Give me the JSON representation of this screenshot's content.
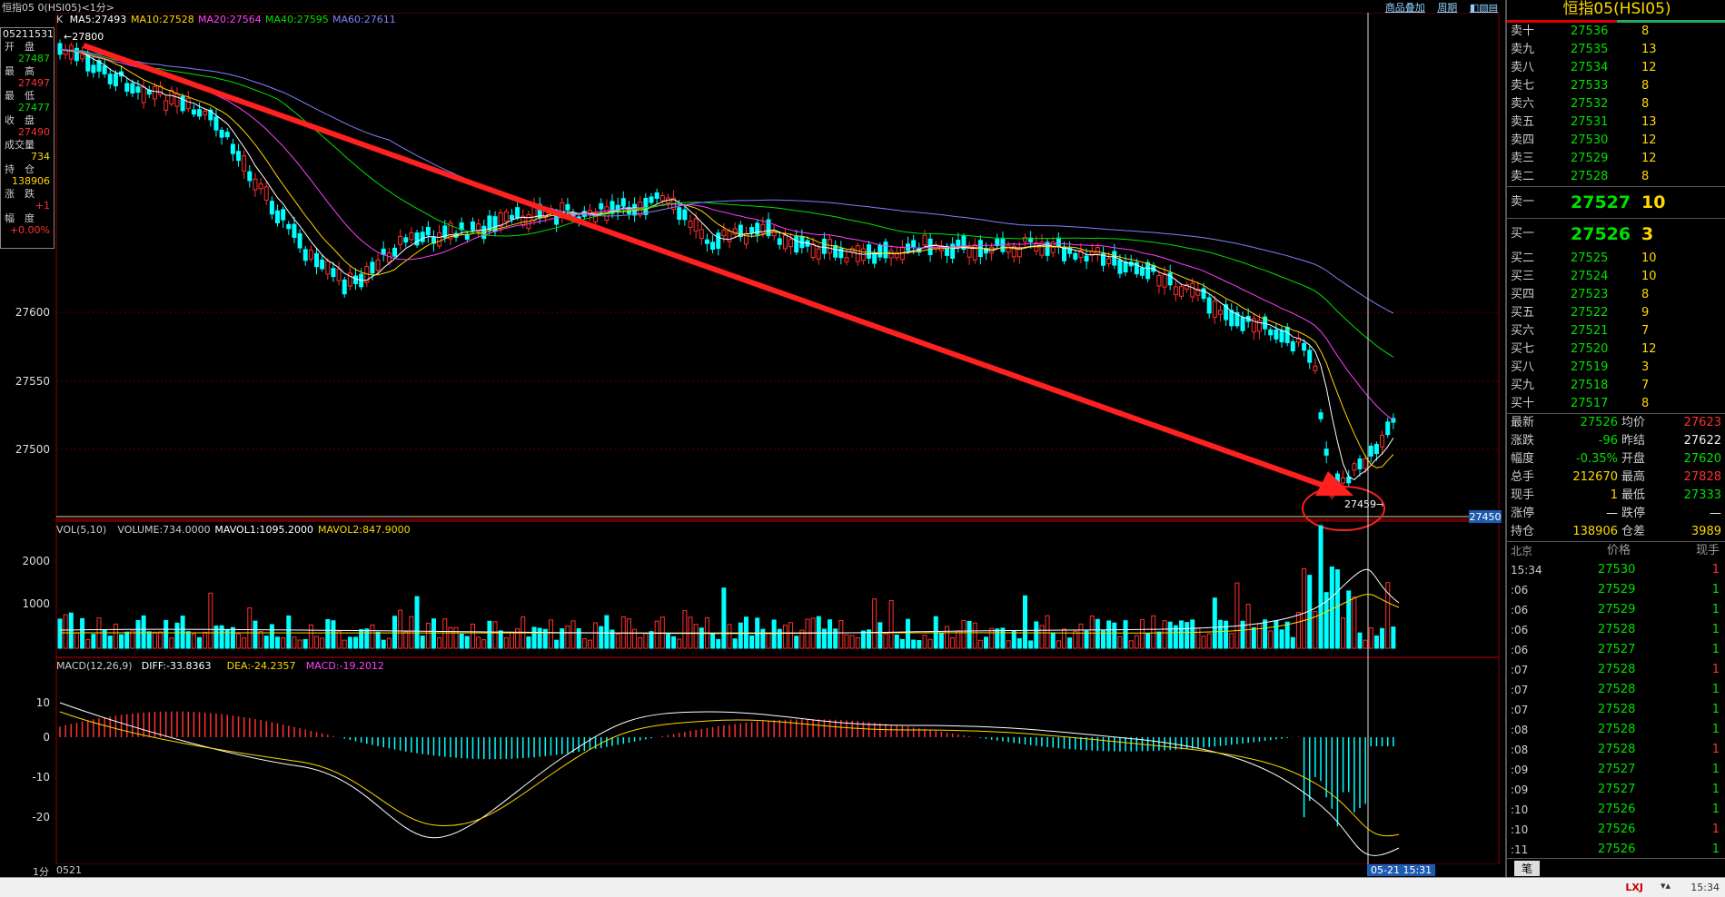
{
  "window": {
    "title": "恒指05 0(HSI05)<1分>",
    "buttons": [
      "商品叠加",
      "周期",
      "◧▧▤"
    ]
  },
  "ohlc_box": {
    "time": "05211531",
    "rows": [
      {
        "label": "开　盘",
        "value": "27487",
        "color": "#00e000"
      },
      {
        "label": "最　高",
        "value": "27497",
        "color": "#ff3030"
      },
      {
        "label": "最　低",
        "value": "27477",
        "color": "#00e000"
      },
      {
        "label": "收　盘",
        "value": "27490",
        "color": "#ff3030"
      },
      {
        "label": "成交量",
        "value": "734",
        "color": "#ffd700"
      },
      {
        "label": "持　仓",
        "value": "138906",
        "color": "#ffd700"
      },
      {
        "label": "涨　跌",
        "value": "+1",
        "color": "#ff3030"
      },
      {
        "label": "幅　度",
        "value": "+0.00%",
        "color": "#ff3030"
      }
    ]
  },
  "main_chart": {
    "legend": [
      {
        "text": "K",
        "color": "#cccccc"
      },
      {
        "text": "MA5:27493",
        "color": "#ffffff"
      },
      {
        "text": "MA10:27528",
        "color": "#ffd700"
      },
      {
        "text": "MA20:27564",
        "color": "#ff40ff"
      },
      {
        "text": "MA40:27595",
        "color": "#00e000"
      },
      {
        "text": "MA60:27611",
        "color": "#8080ff"
      }
    ],
    "y_ticks": [
      "27600",
      "27550",
      "27500"
    ],
    "high_label": "27800",
    "low_label": "27459",
    "price_tag": "27450"
  },
  "volume_chart": {
    "legend": [
      {
        "text": "VOL(5,10)",
        "color": "#cccccc"
      },
      {
        "text": "VOLUME:734.0000",
        "color": "#cccccc"
      },
      {
        "text": "MAVOL1:1095.2000",
        "color": "#ffffff"
      },
      {
        "text": "MAVOL2:847.9000",
        "color": "#ffd700"
      }
    ],
    "y_ticks": [
      "2000",
      "1000"
    ]
  },
  "macd_chart": {
    "legend": [
      {
        "text": "MACD(12,26,9)",
        "color": "#cccccc"
      },
      {
        "text": "DIFF:-33.8363",
        "color": "#ffffff"
      },
      {
        "text": "DEA:-24.2357",
        "color": "#ffd700"
      },
      {
        "text": "MACD:-19.2012",
        "color": "#ff40ff"
      }
    ],
    "y_ticks": [
      "10",
      "0",
      "-10",
      "-20"
    ]
  },
  "bottom": {
    "period": "1分",
    "date": "0521",
    "cursor_time": "05-21 15:31"
  },
  "side": {
    "title": "恒指05(HSI05)",
    "asks": [
      {
        "label": "卖十",
        "price": "27536",
        "qty": "8"
      },
      {
        "label": "卖九",
        "price": "27535",
        "qty": "13"
      },
      {
        "label": "卖八",
        "price": "27534",
        "qty": "12"
      },
      {
        "label": "卖七",
        "price": "27533",
        "qty": "8"
      },
      {
        "label": "卖六",
        "price": "27532",
        "qty": "8"
      },
      {
        "label": "卖五",
        "price": "27531",
        "qty": "13"
      },
      {
        "label": "卖四",
        "price": "27530",
        "qty": "12"
      },
      {
        "label": "卖三",
        "price": "27529",
        "qty": "12"
      },
      {
        "label": "卖二",
        "price": "27528",
        "qty": "8"
      }
    ],
    "ask1": {
      "label": "卖一",
      "price": "27527",
      "qty": "10"
    },
    "bid1": {
      "label": "买一",
      "price": "27526",
      "qty": "3"
    },
    "bids": [
      {
        "label": "买二",
        "price": "27525",
        "qty": "10"
      },
      {
        "label": "买三",
        "price": "27524",
        "qty": "10"
      },
      {
        "label": "买四",
        "price": "27523",
        "qty": "8"
      },
      {
        "label": "买五",
        "price": "27522",
        "qty": "9"
      },
      {
        "label": "买六",
        "price": "27521",
        "qty": "7"
      },
      {
        "label": "买七",
        "price": "27520",
        "qty": "12"
      },
      {
        "label": "买八",
        "price": "27519",
        "qty": "3"
      },
      {
        "label": "买九",
        "price": "27518",
        "qty": "7"
      },
      {
        "label": "买十",
        "price": "27517",
        "qty": "8"
      }
    ],
    "stats": [
      {
        "l1": "最新",
        "v1": "27526",
        "c1": "#00e000",
        "l2": "均价",
        "v2": "27623",
        "c2": "#ff3030"
      },
      {
        "l1": "涨跌",
        "v1": "-96",
        "c1": "#00e000",
        "l2": "昨结",
        "v2": "27622",
        "c2": "#eeeeee"
      },
      {
        "l1": "幅度",
        "v1": "-0.35%",
        "c1": "#00e000",
        "l2": "开盘",
        "v2": "27620",
        "c2": "#00e000"
      },
      {
        "l1": "总手",
        "v1": "212670",
        "c1": "#ffd700",
        "l2": "最高",
        "v2": "27828",
        "c2": "#ff3030"
      },
      {
        "l1": "现手",
        "v1": "1",
        "c1": "#ffd700",
        "l2": "最低",
        "v2": "27333",
        "c2": "#00e000"
      },
      {
        "l1": "涨停",
        "v1": "—",
        "c1": "#eeeeee",
        "l2": "跌停",
        "v2": "—",
        "c2": "#eeeeee"
      },
      {
        "l1": "持仓",
        "v1": "138906",
        "c1": "#ffd700",
        "l2": "仓差",
        "v2": "3989",
        "c2": "#ffd700"
      }
    ],
    "ticks_header": {
      "time": "北京",
      "price": "价格",
      "qty": "现手"
    },
    "ticks": [
      {
        "time": "15:34",
        "price": "27530",
        "qty": "1",
        "qc": "#ff3030"
      },
      {
        "time": ":06",
        "price": "27529",
        "qty": "1",
        "qc": "#00e000"
      },
      {
        "time": ":06",
        "price": "27529",
        "qty": "1",
        "qc": "#00e000"
      },
      {
        "time": ":06",
        "price": "27528",
        "qty": "1",
        "qc": "#00e000"
      },
      {
        "time": ":06",
        "price": "27527",
        "qty": "1",
        "qc": "#00e000"
      },
      {
        "time": ":07",
        "price": "27528",
        "qty": "1",
        "qc": "#ff3030"
      },
      {
        "time": ":07",
        "price": "27528",
        "qty": "1",
        "qc": "#00e000"
      },
      {
        "time": ":07",
        "price": "27528",
        "qty": "1",
        "qc": "#00e000"
      },
      {
        "time": ":08",
        "price": "27528",
        "qty": "1",
        "qc": "#00e000"
      },
      {
        "time": ":08",
        "price": "27528",
        "qty": "1",
        "qc": "#ff3030"
      },
      {
        "time": ":09",
        "price": "27527",
        "qty": "1",
        "qc": "#00e000"
      },
      {
        "time": ":09",
        "price": "27527",
        "qty": "1",
        "qc": "#00e000"
      },
      {
        "time": ":10",
        "price": "27526",
        "qty": "1",
        "qc": "#00e000"
      },
      {
        "time": ":10",
        "price": "27526",
        "qty": "1",
        "qc": "#ff3030"
      },
      {
        "time": ":11",
        "price": "27526",
        "qty": "1",
        "qc": "#00e000"
      }
    ],
    "footer_tab": "笔"
  },
  "statusbar": {
    "connection": "LXJ",
    "time": "15:34"
  }
}
